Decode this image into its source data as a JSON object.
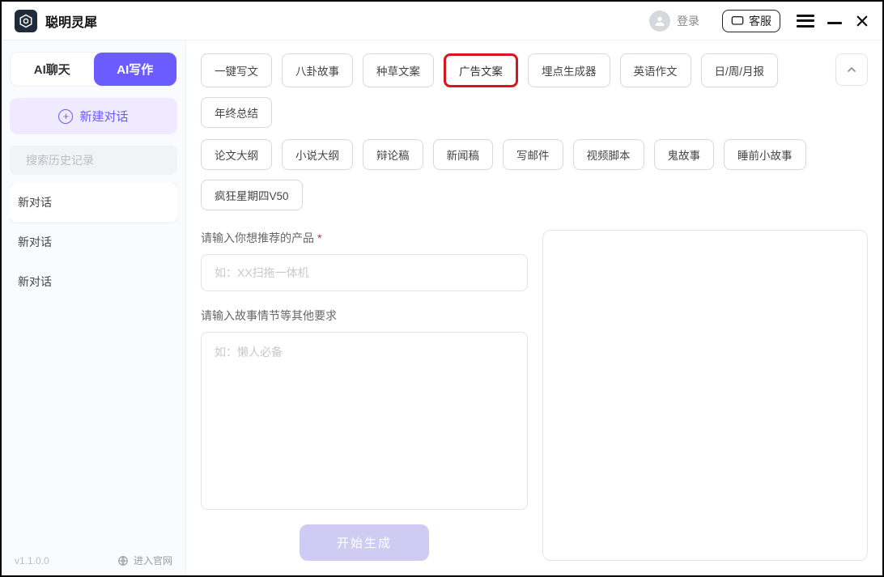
{
  "titlebar": {
    "app_name": "聪明灵犀",
    "login_label": "登录",
    "support_label": "客服"
  },
  "sidebar": {
    "tabs": {
      "chat": "AI聊天",
      "write": "AI写作"
    },
    "new_convo": "新建对话",
    "search_placeholder": "搜索历史记录",
    "history": [
      "新对话",
      "新对话",
      "新对话"
    ],
    "version": "v1.1.0.0",
    "official_site": "进入官网"
  },
  "chips": {
    "row1": [
      "一键写文",
      "八卦故事",
      "种草文案",
      "广告文案",
      "埋点生成器",
      "英语作文",
      "日/周/月报",
      "年终总结"
    ],
    "row2": [
      "论文大纲",
      "小说大纲",
      "辩论稿",
      "新闻稿",
      "写邮件",
      "视频脚本",
      "鬼故事",
      "睡前小故事",
      "疯狂星期四V50"
    ],
    "highlighted": "广告文案"
  },
  "form": {
    "label_product": "请输入你想推荐的产品",
    "placeholder_product": "如：XX扫拖一体机",
    "label_other": "请输入故事情节等其他要求",
    "placeholder_other": "如：懒人必备",
    "generate_label": "开始生成"
  }
}
